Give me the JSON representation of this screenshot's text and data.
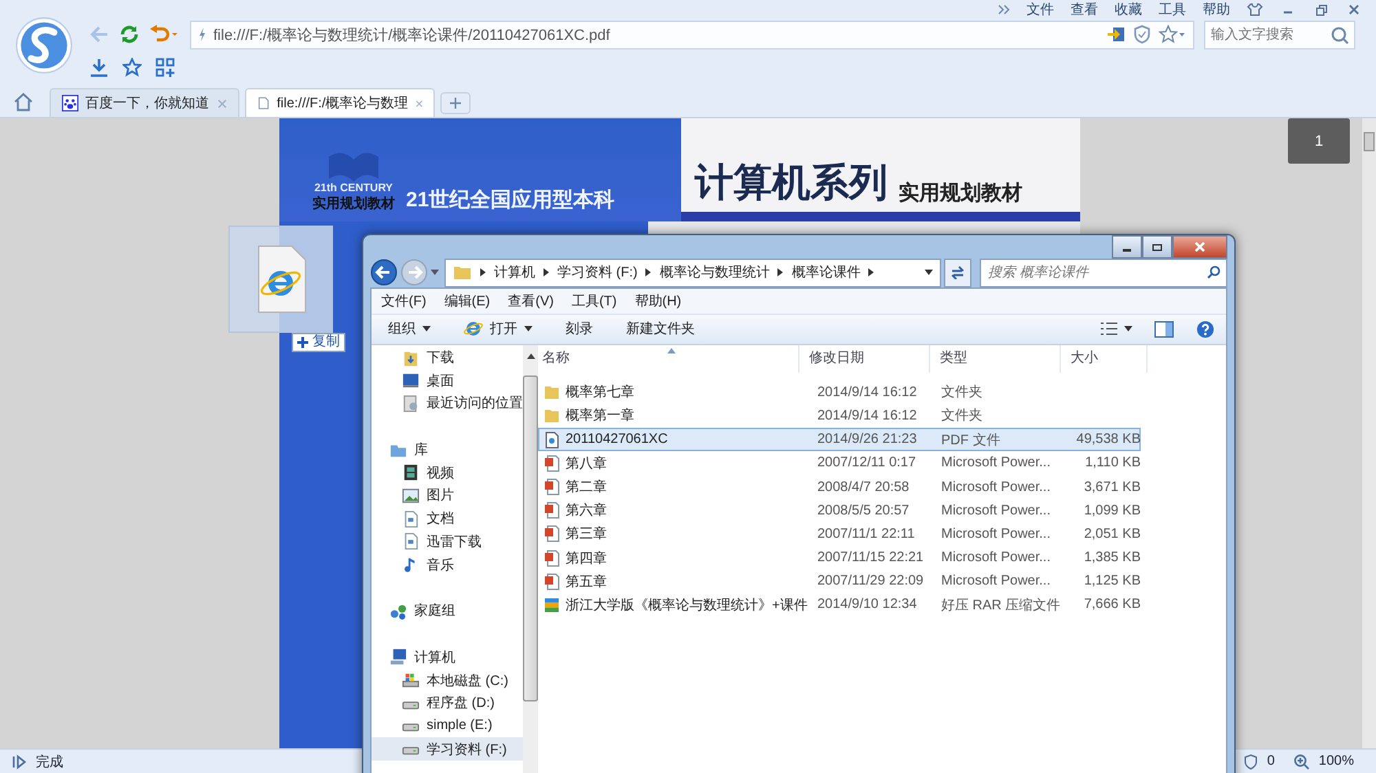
{
  "browser": {
    "menu": [
      "文件",
      "查看",
      "收藏",
      "工具",
      "帮助"
    ],
    "address": "file:///F:/概率论与数理统计/概率论课件/20110427061XC.pdf",
    "search": {
      "placeholder": "输入文字搜索"
    },
    "tabs": [
      {
        "label": "百度一下，你就知道",
        "selected": false,
        "kind": "paw"
      },
      {
        "label": "file:///F:/概率论与数理",
        "selected": true,
        "kind": "page"
      }
    ],
    "status": "完成",
    "blocked_count": "0",
    "zoom": "100%"
  },
  "pdf": {
    "logo_caption": "21th CENTURY",
    "series": "实用规划教材",
    "title_left": "21世纪全国应用型本科",
    "title_main": "计算机系列",
    "subtitle": "实用规划教材",
    "page_number": "1"
  },
  "drag": {
    "badge": "复制"
  },
  "explorer": {
    "breadcrumb": [
      "计算机",
      "学习资料 (F:)",
      "概率论与数理统计",
      "概率论课件"
    ],
    "search": {
      "placeholder": "搜索 概率论课件"
    },
    "menu": [
      "文件(F)",
      "编辑(E)",
      "查看(V)",
      "工具(T)",
      "帮助(H)"
    ],
    "toolbar": [
      {
        "label": "组织",
        "dropdown": true,
        "kind": "plain"
      },
      {
        "label": "打开",
        "dropdown": true,
        "kind": "ie"
      },
      {
        "label": "刻录",
        "dropdown": false,
        "kind": "plain"
      },
      {
        "label": "新建文件夹",
        "dropdown": false,
        "kind": "plain"
      }
    ],
    "nav": [
      {
        "children": [
          {
            "label": "下载",
            "kind": "download",
            "selected": false
          },
          {
            "label": "桌面",
            "kind": "desktop",
            "selected": false
          },
          {
            "label": "最近访问的位置",
            "kind": "recent",
            "selected": false
          }
        ]
      },
      {
        "label": "库",
        "kind": "library",
        "children": [
          {
            "label": "视频",
            "kind": "video",
            "selected": false
          },
          {
            "label": "图片",
            "kind": "picture",
            "selected": false
          },
          {
            "label": "文档",
            "kind": "doc",
            "selected": false
          },
          {
            "label": "迅雷下载",
            "kind": "doc",
            "selected": false
          },
          {
            "label": "音乐",
            "kind": "music",
            "selected": false
          }
        ]
      },
      {
        "label": "家庭组",
        "kind": "homegroup"
      },
      {
        "label": "计算机",
        "kind": "computer",
        "children": [
          {
            "label": "本地磁盘 (C:)",
            "kind": "sysdrive",
            "selected": false
          },
          {
            "label": "程序盘 (D:)",
            "kind": "drive",
            "selected": false
          },
          {
            "label": "simple (E:)",
            "kind": "drive",
            "selected": false
          },
          {
            "label": "学习资料 (F:)",
            "kind": "drive",
            "selected": true
          }
        ]
      }
    ],
    "columns": [
      "名称",
      "修改日期",
      "类型",
      "大小"
    ],
    "rows": [
      {
        "name": "概率第七章",
        "date": "2014/9/14 16:12",
        "type": "文件夹",
        "kind": "folder",
        "selected": false
      },
      {
        "name": "概率第一章",
        "date": "2014/9/14 16:12",
        "type": "文件夹",
        "kind": "folder",
        "selected": false
      },
      {
        "name": "20110427061XC",
        "date": "2014/9/26 21:23",
        "type": "PDF 文件",
        "size": "49,538 KB",
        "kind": "pdf",
        "selected": true
      },
      {
        "name": "第八章",
        "date": "2007/12/11 0:17",
        "type": "Microsoft Power...",
        "size": "1,110 KB",
        "kind": "ppt",
        "selected": false
      },
      {
        "name": "第二章",
        "date": "2008/4/7 20:58",
        "type": "Microsoft Power...",
        "size": "3,671 KB",
        "kind": "ppt",
        "selected": false
      },
      {
        "name": "第六章",
        "date": "2008/5/5 20:57",
        "type": "Microsoft Power...",
        "size": "1,099 KB",
        "kind": "ppt",
        "selected": false
      },
      {
        "name": "第三章",
        "date": "2007/11/1 22:11",
        "type": "Microsoft Power...",
        "size": "2,051 KB",
        "kind": "ppt",
        "selected": false
      },
      {
        "name": "第四章",
        "date": "2007/11/15 22:21",
        "type": "Microsoft Power...",
        "size": "1,385 KB",
        "kind": "ppt",
        "selected": false
      },
      {
        "name": "第五章",
        "date": "2007/11/29 22:09",
        "type": "Microsoft Power...",
        "size": "1,125 KB",
        "kind": "ppt",
        "selected": false
      },
      {
        "name": "浙江大学版《概率论与数理统计》+课件",
        "date": "2014/9/10 12:34",
        "type": "好压 RAR 压缩文件",
        "size": "7,666 KB",
        "kind": "rar",
        "selected": false
      }
    ]
  }
}
